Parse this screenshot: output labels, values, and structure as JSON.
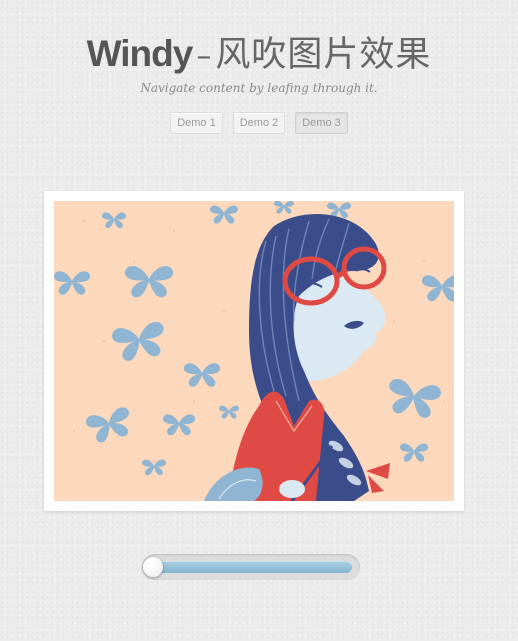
{
  "header": {
    "title_brand": "Windy",
    "title_dash": "–",
    "title_chinese": "风吹图片效果",
    "subtitle": "Navigate content by leafing through it."
  },
  "demos": [
    {
      "label": "Demo 1",
      "active": false
    },
    {
      "label": "Demo 2",
      "active": false
    },
    {
      "label": "Demo 3",
      "active": true
    }
  ],
  "slider": {
    "value": 0,
    "fill_fraction": 1.0
  },
  "colors": {
    "background": "#ececec",
    "illustration_bg": "#fcd9bd",
    "butterfly": "#8fb5d2",
    "hair": "#3a4d8a",
    "accent_red": "#e04a45",
    "slider_track": "#9cc6dc"
  }
}
